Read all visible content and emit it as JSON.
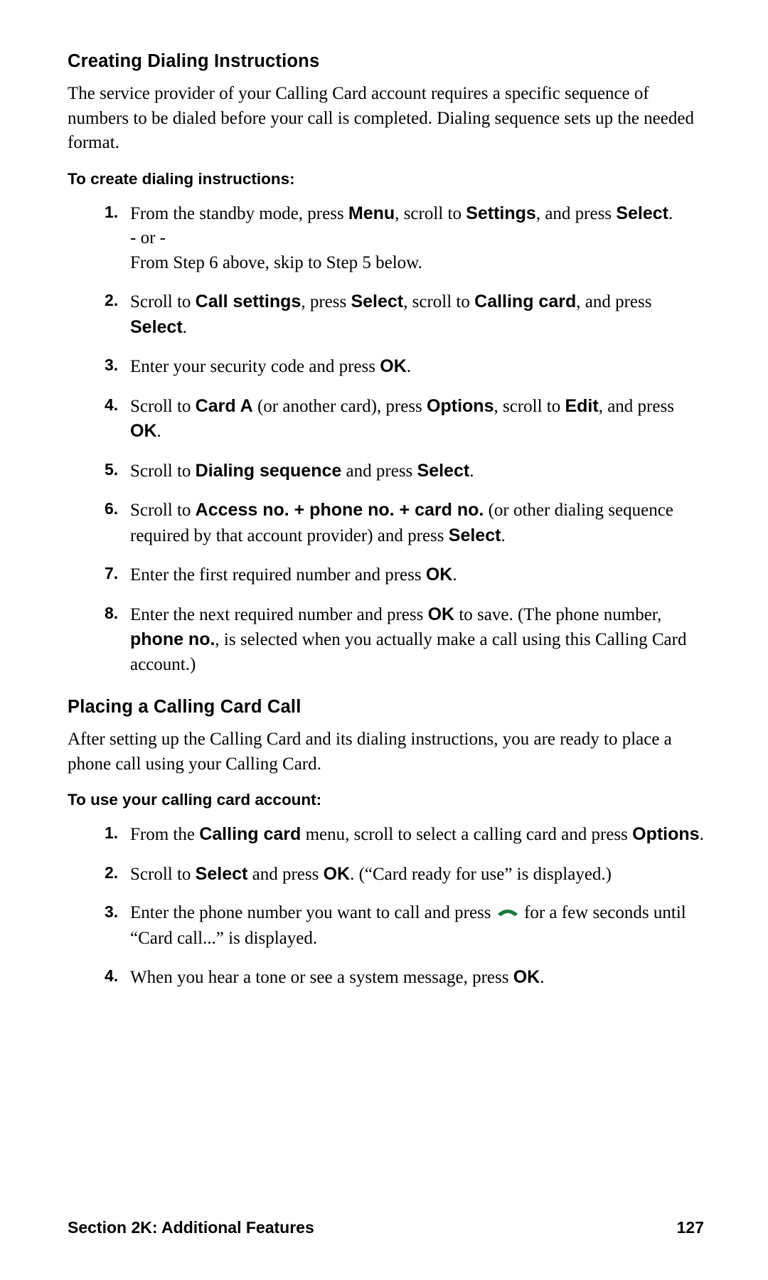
{
  "section1": {
    "heading": "Creating Dialing Instructions",
    "intro": "The service provider of your Calling Card account requires a specific sequence of numbers to be dialed before your call is completed. Dialing sequence sets up the needed format.",
    "subhead": "To create dialing instructions:",
    "steps": {
      "s1_a": "From the standby mode, press ",
      "s1_b": ", scroll to ",
      "s1_c": ", and press ",
      "s1_or": "- or -",
      "s1_d": "From Step 6 above, skip to Step 5 below.",
      "s2_a": "Scroll to ",
      "s2_b": ", press ",
      "s2_c": ", scroll to ",
      "s2_d": ", and press ",
      "s3_a": "Enter your security code and press ",
      "s4_a": "Scroll to ",
      "s4_b": " (or another card), press ",
      "s4_c": ", scroll to ",
      "s4_d": ", and press ",
      "s5_a": "Scroll to ",
      "s5_b": " and press ",
      "s6_a": "Scroll to ",
      "s6_b": " (or other dialing sequence required by that account provider) and press ",
      "s7_a": "Enter the first required number and press ",
      "s8_a": "Enter the next required number and press ",
      "s8_b": " to save. (The phone number, ",
      "s8_c": ", is selected when you actually make a call using this Calling Card account.)"
    },
    "ui": {
      "menu": "Menu",
      "settings": "Settings",
      "select": "Select",
      "call_settings": "Call settings",
      "calling_card": "Calling card",
      "ok": "OK",
      "card_a": "Card A",
      "options": "Options",
      "edit": "Edit",
      "dialing_sequence": "Dialing sequence",
      "access_seq": "Access no. + phone no. + card no.",
      "phone_no": "phone no."
    },
    "nums": {
      "n1": "1.",
      "n2": "2.",
      "n3": "3.",
      "n4": "4.",
      "n5": "5.",
      "n6": "6.",
      "n7": "7.",
      "n8": "8."
    }
  },
  "section2": {
    "heading": "Placing a Calling Card Call",
    "intro": "After setting up the Calling Card and its dialing instructions, you are ready to place a phone call using your Calling Card.",
    "subhead": "To use your calling card account:",
    "steps": {
      "s1_a": "From the ",
      "s1_b": " menu, scroll to select a calling card and press ",
      "s2_a": "Scroll to ",
      "s2_b": " and press ",
      "s2_c": ". (“Card ready for use” is displayed.)",
      "s3_a": "Enter the phone number you want to call and press ",
      "s3_b": " for a few seconds until “Card call...” is displayed.",
      "s4_a": "When you hear a tone or see a system message, press "
    },
    "ui": {
      "calling_card": "Calling card",
      "options": "Options",
      "select": "Select",
      "ok": "OK"
    },
    "nums": {
      "n1": "1.",
      "n2": "2.",
      "n3": "3.",
      "n4": "4."
    }
  },
  "footer": {
    "left": "Section 2K: Additional Features",
    "right": "127"
  },
  "punct": {
    "period": "."
  }
}
